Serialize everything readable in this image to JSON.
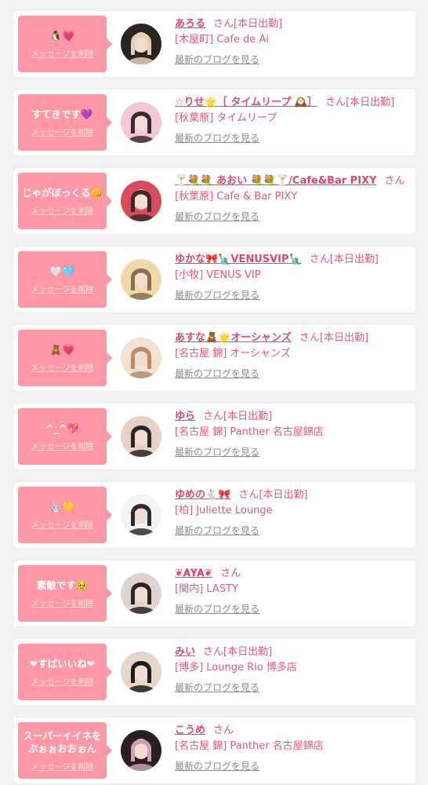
{
  "delete_label": "メッセージを削除",
  "blog_label": "最新のブログを見る",
  "san_label": "さん",
  "cards": [
    {
      "message": "🐧💗",
      "name": "あろる",
      "status": "[本日出勤]",
      "shop": "[木屋町] Cafe de Ai",
      "avatar_colors": [
        "#2b2522",
        "#e9cbb6"
      ]
    },
    {
      "message": "すてきです💜",
      "name": "☆りせ🌟［ タイムリープ 🕰️］",
      "status": "[本日出勤]",
      "shop": "[秋葉原] タイムリープ",
      "avatar_colors": [
        "#f3c7d8",
        "#3b2a2f"
      ]
    },
    {
      "message": "じゃがぼっくる👊",
      "name": "🍸💐💐 あおい 💐💐🍸/Cafe&Bar PIXY",
      "status": "",
      "shop": "[秋葉原] Cafe & Bar PIXY",
      "avatar_colors": [
        "#d94a5c",
        "#3a2a2a"
      ]
    },
    {
      "message": "🤍🩵",
      "name": "ゆかな🎀🗽VENUSVIP🗽",
      "status": "[本日出勤]",
      "shop": "[小牧] VENUS VIP",
      "avatar_colors": [
        "#f0d9a8",
        "#8a6c55"
      ]
    },
    {
      "message": "🧸💗",
      "name": "あすな🧸🌟オーシャンズ",
      "status": "[本日出勤]",
      "shop": "[名古屋 錦] オーシャンズ",
      "avatar_colors": [
        "#f2e2cf",
        "#b98d6a"
      ]
    },
    {
      "message": "^_^💖",
      "name": "ゆら",
      "status": "[本日出勤]",
      "shop": "[名古屋 錦] Panther 名古屋錦店",
      "avatar_colors": [
        "#e8d0c4",
        "#2c2424"
      ]
    },
    {
      "message": "🐰💛",
      "name": "ゆめの🐇🎀",
      "status": "[本日出勤]",
      "shop": "[柏] Juliette Lounge",
      "avatar_colors": [
        "#f3f3f6",
        "#2d2a2e"
      ]
    },
    {
      "message": "素敵です🥹",
      "name": "❦𝐀𝐘𝐀❦",
      "status": "",
      "shop": "[関内] LASTY",
      "avatar_colors": [
        "#e0d2cc",
        "#2a2424"
      ]
    },
    {
      "message": "❤すばいいね❤",
      "name": "みい",
      "status": "[本日出勤]",
      "shop": "[博多] Lounge Rio 博多店",
      "avatar_colors": [
        "#e7d6c6",
        "#1f1b1b"
      ]
    },
    {
      "message": "スーパーイイネを\nぷぉぉおおぉん",
      "name": "こうめ",
      "status": "",
      "shop": "[名古屋 錦] Panther 名古屋錦店",
      "avatar_colors": [
        "#2a2024",
        "#cf9fb1"
      ]
    }
  ]
}
